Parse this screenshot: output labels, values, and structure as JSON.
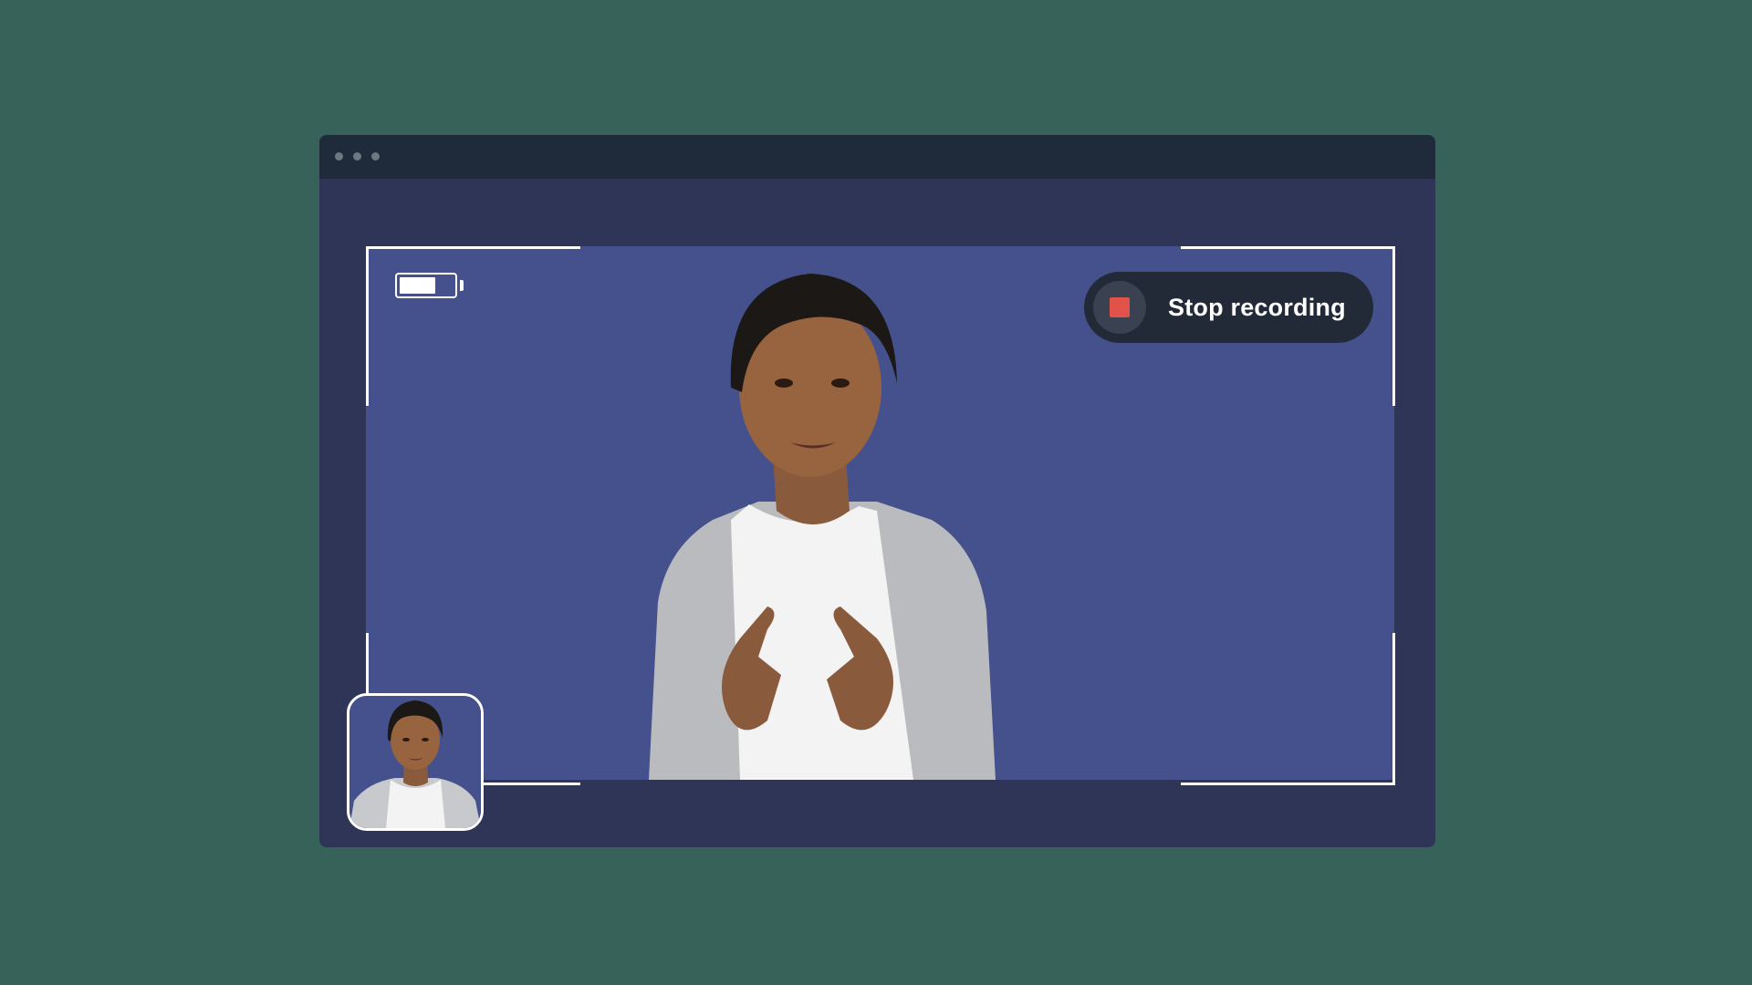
{
  "window": {
    "titlebar_dots": [
      "dot",
      "dot",
      "dot"
    ]
  },
  "recorder": {
    "stop_label": "Stop recording",
    "stop_color": "#e0524a",
    "battery_level_fraction": 0.65
  },
  "colors": {
    "background": "#37625a",
    "window": "#2f3557",
    "titlebar": "#1f2b3b",
    "stage": "#45518c",
    "button": "#222a38"
  }
}
